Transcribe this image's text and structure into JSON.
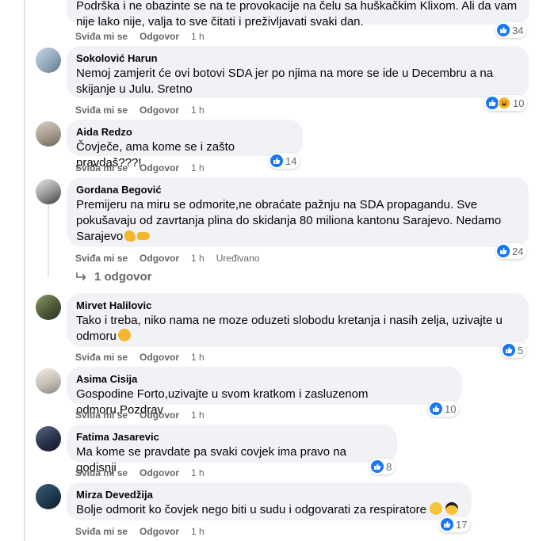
{
  "labels": {
    "like": "Sviđa mi se",
    "reply": "Odgovor",
    "edited": "Uređivano"
  },
  "top_comment": {
    "text_line1": "Podrška i ne obazinte se na te provokacije na čelu sa huškačkim Klixom. Ali da vam",
    "text_line2": "nije lako nije, valja to sve čitati i preživljavati svaki dan.",
    "time": "1 h",
    "reactions": "34"
  },
  "comments": [
    {
      "author": "Sokolović Harun",
      "text": "Nemoj zamjerit će ovi botovi SDA jer po njima na more se ide u Decembru a na skijanje u Julu. Sretno",
      "time": "1 h",
      "reactions": "10"
    },
    {
      "author": "Aida Redzo",
      "text": "Čovječe, ama kome se i zašto pravdaš???!",
      "time": "1 h",
      "reactions": "14"
    },
    {
      "author": "Gordana Begović",
      "text": "Premijeru na miru se odmorite,ne obraćate pažnju na SDA propagandu. Sve pokušavaju od zavrtanja plina do skidanja 80 miliona kantonu Sarajevo. Nedamo Sarajevo",
      "time": "1 h",
      "reactions": "24"
    },
    {
      "author": "Mirvet Halilovic",
      "text": "Tako i treba, niko nama ne moze oduzeti slobodu kretanja i nasih zelja, uzivajte u odmoru",
      "time": "1 h",
      "reactions": "5"
    },
    {
      "author": "Asima Cisija",
      "text": "Gospodine Forto,uzivajte u svom kratkom i zasluzenom odmoru.Pozdrav",
      "time": "1 h",
      "reactions": "10"
    },
    {
      "author": "Fatima Jasarevic",
      "text": "Ma kome se pravdate pa svaki covjek ima pravo na godisnji",
      "time": "1 h",
      "reactions": "8"
    },
    {
      "author": "Mirza Devedžija",
      "text": "Bolje odmorit ko čovjek nego biti u sudu i odgovarati za respiratore",
      "time": "1 h",
      "reactions": "17"
    }
  ],
  "reply_link": "1 odgovor",
  "colors": {
    "like": "#1877f2",
    "haha": "#f7b125",
    "bubble": "#f0f2f5",
    "muted": "#65676b"
  }
}
